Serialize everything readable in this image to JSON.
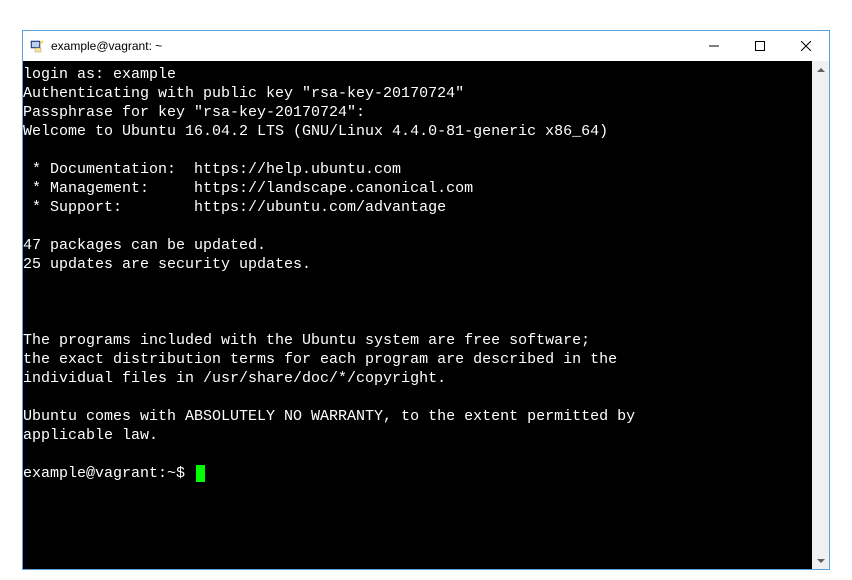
{
  "window": {
    "title": "example@vagrant: ~"
  },
  "terminal": {
    "lines": [
      "login as: example",
      "Authenticating with public key \"rsa-key-20170724\"",
      "Passphrase for key \"rsa-key-20170724\":",
      "Welcome to Ubuntu 16.04.2 LTS (GNU/Linux 4.4.0-81-generic x86_64)",
      "",
      " * Documentation:  https://help.ubuntu.com",
      " * Management:     https://landscape.canonical.com",
      " * Support:        https://ubuntu.com/advantage",
      "",
      "47 packages can be updated.",
      "25 updates are security updates.",
      "",
      "",
      "",
      "The programs included with the Ubuntu system are free software;",
      "the exact distribution terms for each program are described in the",
      "individual files in /usr/share/doc/*/copyright.",
      "",
      "Ubuntu comes with ABSOLUTELY NO WARRANTY, to the extent permitted by",
      "applicable law.",
      ""
    ],
    "prompt": "example@vagrant:~$ "
  }
}
